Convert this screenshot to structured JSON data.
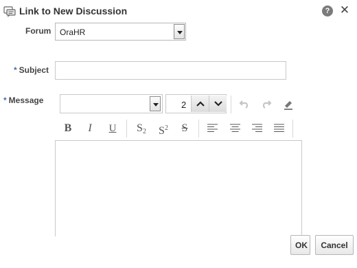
{
  "dialog": {
    "title": "Link to New Discussion",
    "help_symbol": "?",
    "close_symbol": "✕"
  },
  "form": {
    "required_marker": "*",
    "forum_label": "Forum",
    "forum_value": "OraHR",
    "subject_label": "Subject",
    "subject_value": "",
    "message_label": "Message"
  },
  "toolbar": {
    "font_size_value": "2",
    "bold": "B",
    "italic": "I",
    "underline": "U",
    "subscript_base": "S",
    "subscript_mark": "2",
    "superscript_base": "S",
    "superscript_mark": "2",
    "strikethrough": "S"
  },
  "buttons": {
    "ok": "OK",
    "cancel": "Cancel"
  }
}
